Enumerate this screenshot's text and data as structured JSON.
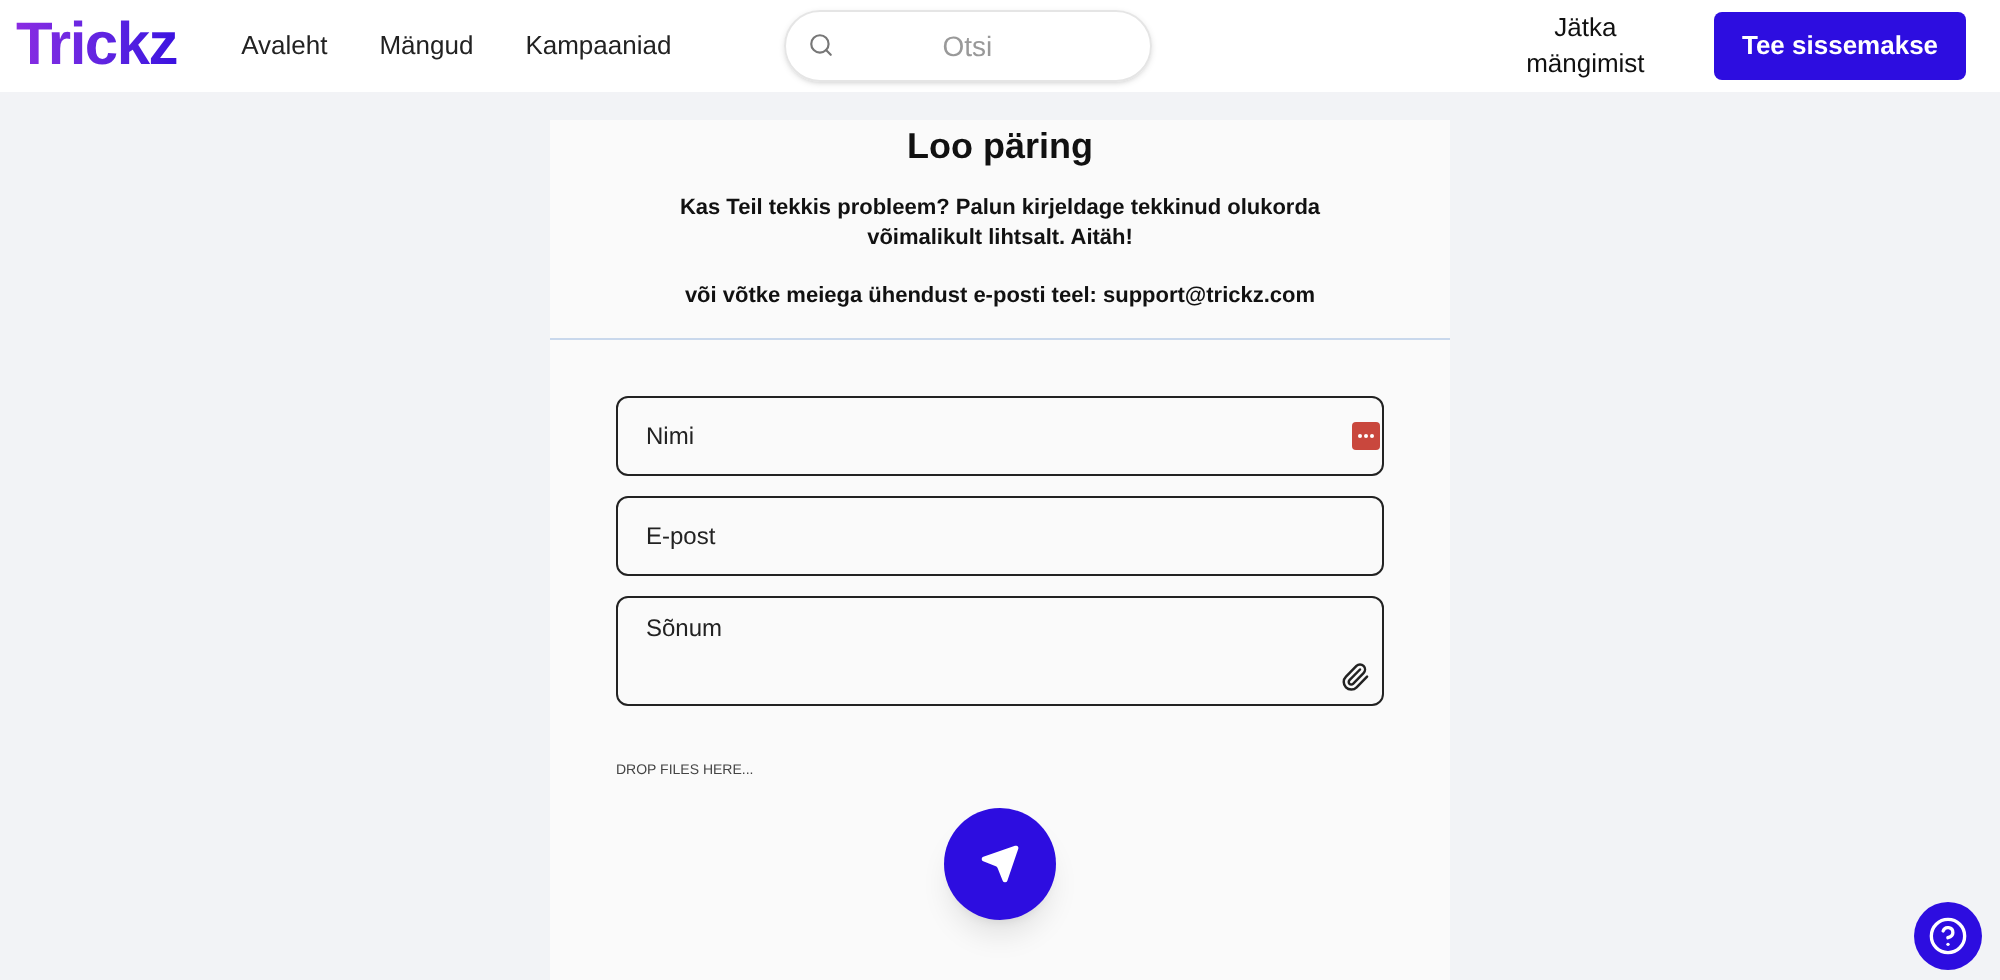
{
  "header": {
    "logo": "Trickz",
    "nav": [
      {
        "label": "Avaleht"
      },
      {
        "label": "Mängud"
      },
      {
        "label": "Kampaaniad"
      }
    ],
    "search": {
      "placeholder": "Otsi"
    },
    "continue_link": "Jätka mängimist",
    "deposit_button": "Tee sissemakse"
  },
  "form": {
    "title": "Loo päring",
    "description": "Kas Teil tekkis probleem? Palun kirjeldage tekkinud olukorda võimalikult lihtsalt. Aitäh!",
    "contact": "või võtke meiega ühendust e-posti teel: support@trickz.com",
    "fields": [
      {
        "kind": "text",
        "placeholder": "Nimi"
      },
      {
        "kind": "text",
        "placeholder": "E-post"
      },
      {
        "kind": "textarea",
        "placeholder": "Sõnum"
      }
    ],
    "dropzone": "DROP FILES HERE..."
  }
}
